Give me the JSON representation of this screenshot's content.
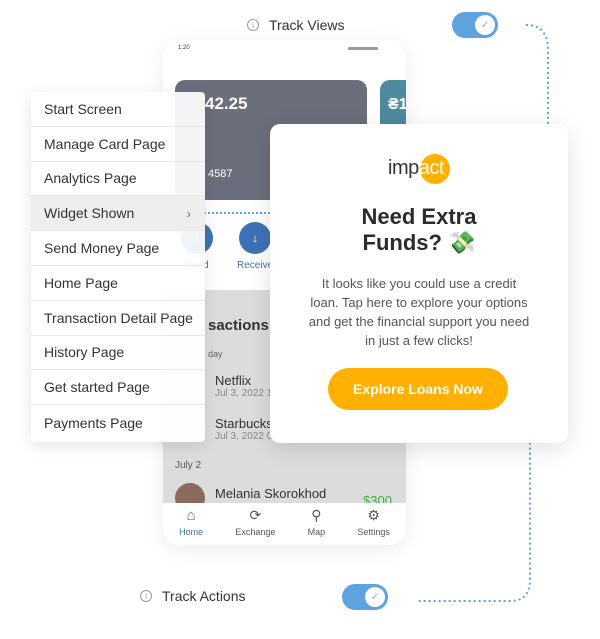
{
  "track_views": {
    "label": "Track Views",
    "enabled": true
  },
  "track_actions": {
    "label": "Track Actions",
    "enabled": true
  },
  "phone": {
    "status_time": "1:20",
    "card_balance": "42.25",
    "card_number": "4587",
    "second_card": "₴1",
    "actions": [
      {
        "label": "Send"
      },
      {
        "label": "Receive"
      }
    ],
    "transactions_title": "sactions",
    "group1": "day",
    "transactions": [
      {
        "name": "Netflix",
        "date": "Jul 3, 2022 1"
      },
      {
        "name": "Starbucks",
        "date": "Jul 3, 2022 0"
      }
    ],
    "group2": "July 2",
    "melania": {
      "name": "Melania Skorokhod",
      "amount": "$300"
    },
    "nav": [
      {
        "label": "Home",
        "icon": "home-icon"
      },
      {
        "label": "Exchange",
        "icon": "exchange-icon"
      },
      {
        "label": "Map",
        "icon": "map-pin-icon"
      },
      {
        "label": "Settings",
        "icon": "gear-icon"
      }
    ]
  },
  "menu": {
    "items": [
      {
        "label": "Start Screen"
      },
      {
        "label": "Manage Card Page"
      },
      {
        "label": "Analytics Page"
      },
      {
        "label": "Widget Shown",
        "submenu": true
      },
      {
        "label": "Send Money Page"
      },
      {
        "label": "Home Page"
      },
      {
        "label": "Transaction Detail Page"
      },
      {
        "label": "History Page"
      },
      {
        "label": "Get started Page"
      },
      {
        "label": "Payments Page"
      }
    ]
  },
  "promo": {
    "logo": "impact",
    "title_line1": "Need Extra",
    "title_line2": "Funds? 💸",
    "body": "It looks like you could use a credit loan. Tap here to explore your options and get the financial support you need in just a few clicks!",
    "button": "Explore Loans Now"
  },
  "colors": {
    "accent": "#5ea2e0",
    "button": "#ffb000",
    "amount": "#3cb043"
  }
}
